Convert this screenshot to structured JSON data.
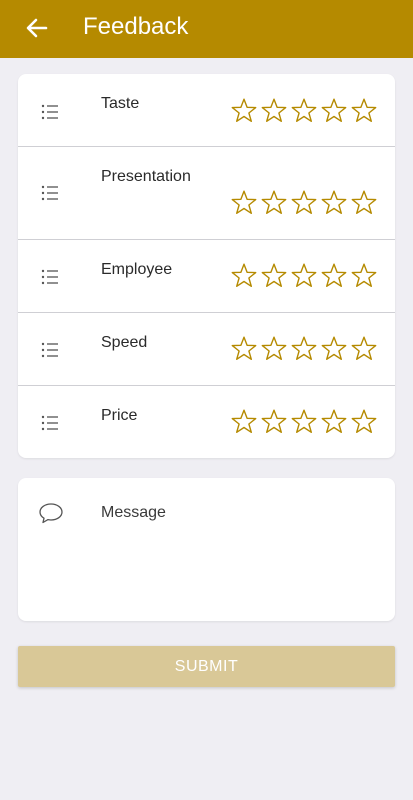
{
  "header": {
    "title": "Feedback",
    "back_icon": "arrow-left-icon"
  },
  "ratings": {
    "star_color": "#b58a00",
    "max_stars": 5,
    "items": [
      {
        "label": "Taste",
        "rating": 0
      },
      {
        "label": "Presentation",
        "rating": 0
      },
      {
        "label": "Employee",
        "rating": 0
      },
      {
        "label": "Speed",
        "rating": 0
      },
      {
        "label": "Price",
        "rating": 0
      }
    ]
  },
  "message": {
    "placeholder": "Message",
    "icon": "chat-bubble-icon"
  },
  "submit": {
    "label": "SUBMIT"
  },
  "colors": {
    "appbar": "#b58a00",
    "background": "#efeef3",
    "submit_bg": "#d9c897"
  }
}
